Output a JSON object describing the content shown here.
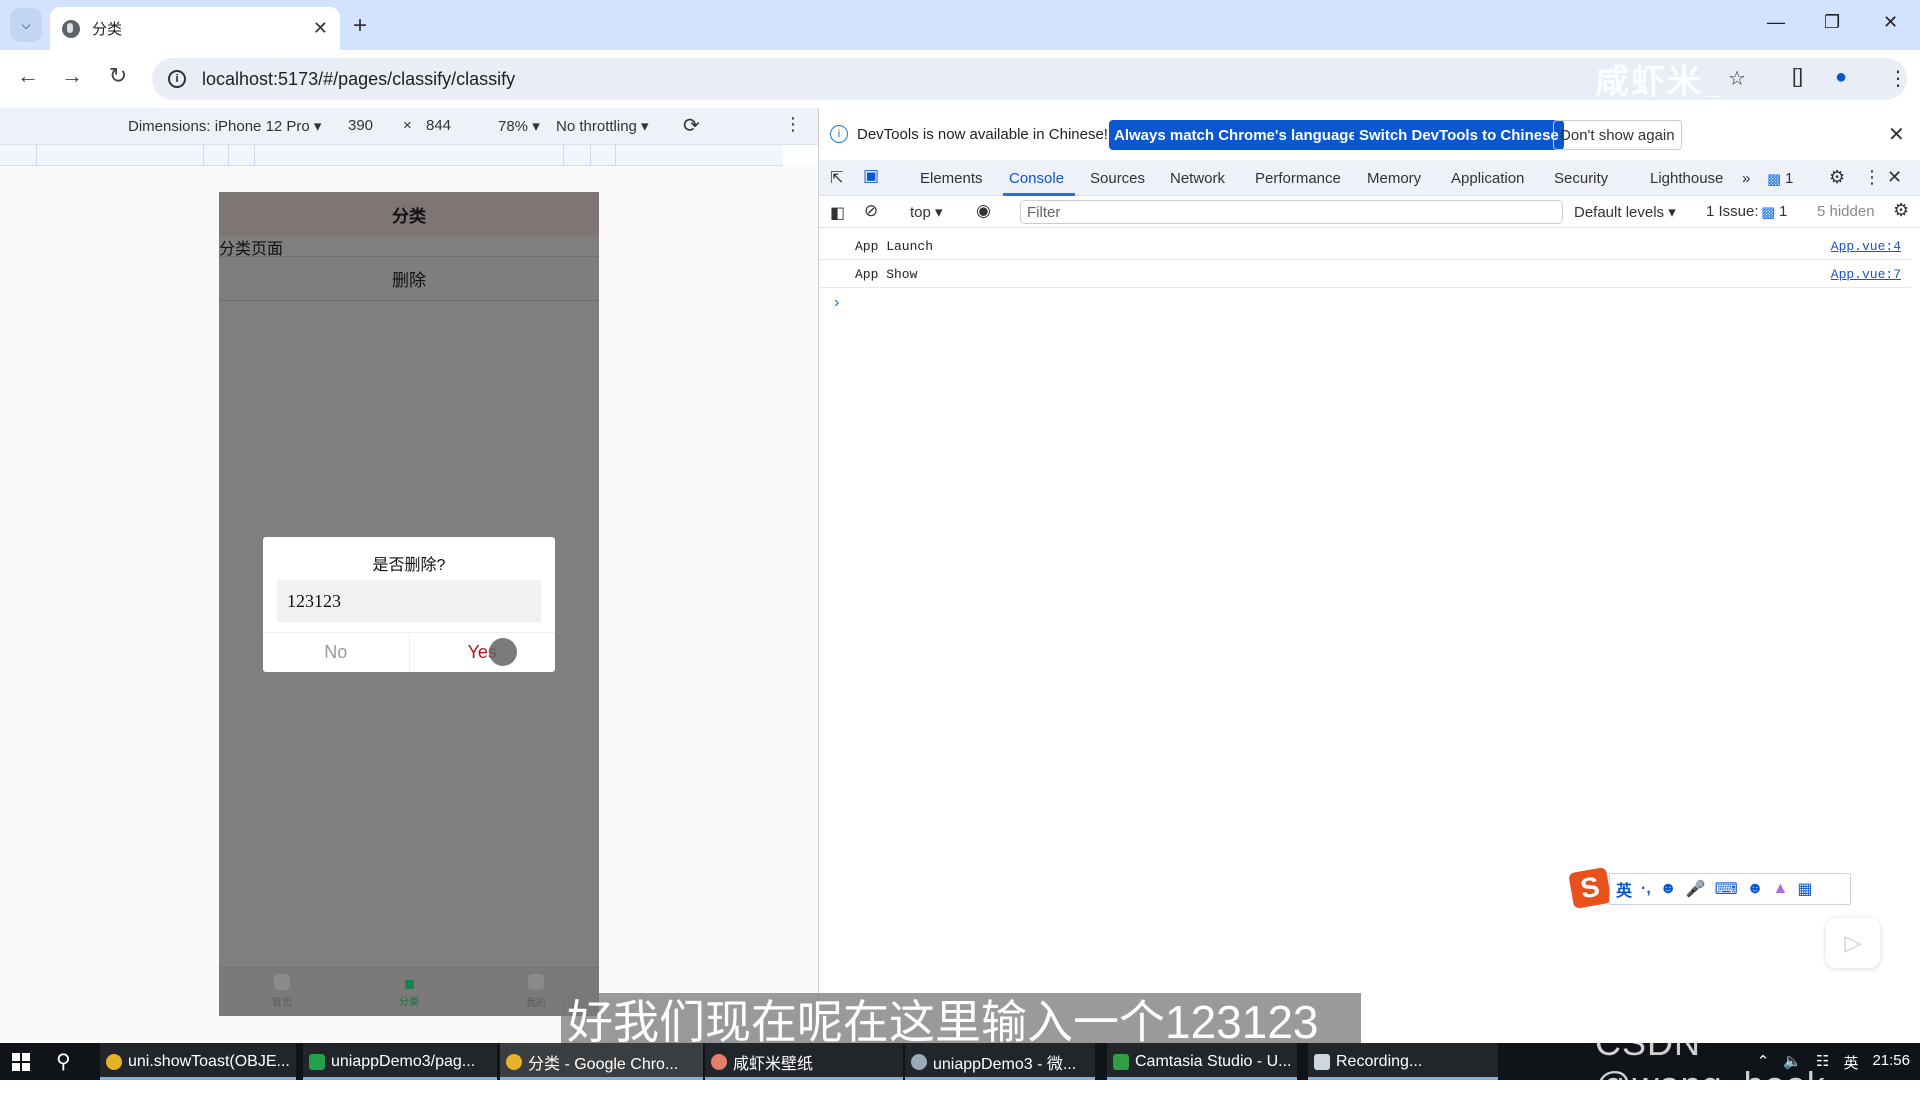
{
  "browser": {
    "tab_title": "分类",
    "url": "localhost:5173/#/pages/classify/classify",
    "watermark": "咸虾米_",
    "window_controls": [
      "minimize-icon",
      "restore-icon",
      "close-icon"
    ]
  },
  "device_toolbar": {
    "dimensions_label": "Dimensions: iPhone 12 Pro ▾",
    "width": "390",
    "times": "×",
    "height": "844",
    "zoom": "78% ▾",
    "throttling": "No throttling ▾"
  },
  "phone": {
    "nav_title": "分类",
    "page_text": "分类页面",
    "delete_button": "删除",
    "tabbar": [
      {
        "label": "首页",
        "active": false
      },
      {
        "label": "分类",
        "active": true
      },
      {
        "label": "我的",
        "active": false
      }
    ],
    "modal": {
      "title": "是否删除?",
      "input_value": "123123",
      "cancel": "No",
      "confirm": "Yes",
      "confirm_color": "#c0111a"
    }
  },
  "devtools": {
    "infobar": {
      "message": "DevTools is now available in Chinese!",
      "btn_match": "Always match Chrome's language",
      "btn_switch": "Switch DevTools to Chinese",
      "btn_dismiss": "Don't show again"
    },
    "tabs": [
      "Elements",
      "Console",
      "Sources",
      "Network",
      "Performance",
      "Memory",
      "Application",
      "Security",
      "Lighthouse"
    ],
    "active_tab": "Console",
    "more_tabs": "»",
    "issues_badge": "1",
    "console": {
      "context": "top ▾",
      "filter_placeholder": "Filter",
      "levels": "Default levels ▾",
      "issues_label": "1 Issue:",
      "issues_count": "1",
      "hidden": "5 hidden"
    },
    "logs": [
      {
        "message": "App  Launch",
        "source": "App.vue:4"
      },
      {
        "message": "App  Show",
        "source": "App.vue:7"
      }
    ]
  },
  "ime": {
    "mode": "英",
    "punct": "·,"
  },
  "subtitle": "好我们现在呢在这里输入一个123123",
  "taskbar": {
    "apps": [
      {
        "label": "uni.showToast(OBJE...",
        "icon": "chrome-icon",
        "color": "#e6b325"
      },
      {
        "label": "uniappDemo3/pag...",
        "icon": "hbuilder-icon",
        "color": "#22a04a"
      },
      {
        "label": "分类 - Google Chro...",
        "icon": "chrome-icon",
        "color": "#e6b325"
      },
      {
        "label": "咸虾米壁纸",
        "icon": "app-icon",
        "color": "#e87c6a"
      },
      {
        "label": "uniappDemo3 - 微...",
        "icon": "wechat-devtools-icon",
        "color": "#9aa8b8"
      },
      {
        "label": "Camtasia Studio - U...",
        "icon": "camtasia-icon",
        "color": "#2f9e44"
      },
      {
        "label": "Recording...",
        "icon": "camtasia-icon",
        "color": "#cfd8dc"
      }
    ],
    "tray_lang": "英",
    "clock": "21:56"
  },
  "csdn_watermark": "CSDN @wang_book"
}
